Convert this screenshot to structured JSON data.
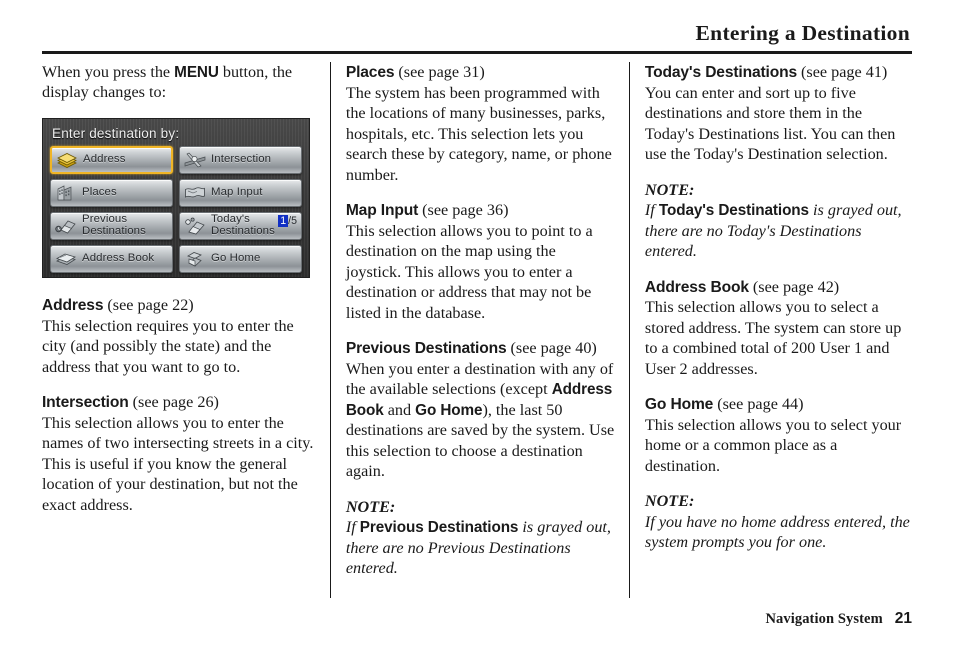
{
  "header": {
    "title": "Entering a Destination"
  },
  "footer": {
    "label": "Navigation System",
    "page": "21"
  },
  "left_column": {
    "intro_pre": "When you press the ",
    "intro_bold": "MENU",
    "intro_post": " button, the display changes to:",
    "nav_screen": {
      "title": "Enter destination by:",
      "buttons": [
        {
          "label": "Address",
          "icon": "address-stack-icon",
          "selected": true,
          "counter": null
        },
        {
          "label": "Intersection",
          "icon": "intersection-roads-icon",
          "selected": false,
          "counter": null
        },
        {
          "label": "Places",
          "icon": "places-buildings-icon",
          "selected": false,
          "counter": null
        },
        {
          "label": "Map Input",
          "icon": "map-input-icon",
          "selected": false,
          "counter": null
        },
        {
          "label": "Previous\nDestinations",
          "icon": "previous-destinations-icon",
          "selected": false,
          "counter": null
        },
        {
          "label": "Today's\nDestinations",
          "icon": "todays-destinations-icon",
          "selected": false,
          "counter": {
            "current": "1",
            "total": "/5"
          }
        },
        {
          "label": "Address Book",
          "icon": "address-book-icon",
          "selected": false,
          "counter": null
        },
        {
          "label": "Go Home",
          "icon": "go-home-icon",
          "selected": false,
          "counter": null
        }
      ]
    },
    "sections": [
      {
        "heading": "Address",
        "ref": " (see page 22)",
        "body": "This selection requires you to enter the city (and possibly the state) and the address that you want to go to."
      },
      {
        "heading": "Intersection",
        "ref": " (see page 26)",
        "body": "This selection allows you to enter the names of two intersecting streets in a city. This is useful if you know the general location of your destination, but not the exact address."
      }
    ]
  },
  "middle_column": {
    "places": {
      "heading": "Places",
      "ref": " (see page 31)",
      "body": "The system has been programmed with the locations of many businesses, parks, hospitals, etc. This selection lets you search these by category, name, or phone number."
    },
    "map_input": {
      "heading": "Map Input",
      "ref": " (see page 36)",
      "body": "This selection allows you to point to a destination on the map using the joystick. This allows you to enter a destination or address that may not be listed in the database."
    },
    "previous_destinations": {
      "heading": "Previous Destinations",
      "ref": " (see page 40)",
      "body_1": "When you enter a destination with any of the available selections (except ",
      "bold_1": "Address Book",
      "body_2": " and ",
      "bold_2": "Go Home",
      "body_3": "), the last 50 destinations are saved by the system. Use this selection to choose a destination again."
    },
    "note": {
      "label": "NOTE:",
      "pre": "If ",
      "bold": "Previous Destinations",
      "post": " is grayed out, there are no Previous Destinations entered."
    }
  },
  "right_column": {
    "todays_destinations": {
      "heading": "Today's Destinations",
      "ref": " (see page 41)",
      "body": "You can enter and sort up to five destinations and store them in the Today's Destinations list. You can then use the Today's Destination selection."
    },
    "note_1": {
      "label": "NOTE:",
      "pre": "If ",
      "bold": "Today's Destinations",
      "post": " is grayed out, there are no Today's Destinations entered."
    },
    "address_book": {
      "heading": "Address Book",
      "ref": " (see page 42)",
      "body": "This selection allows you to select a stored address. The system can store up to a combined total of  200 User 1 and User 2 addresses."
    },
    "go_home": {
      "heading": "Go Home",
      "ref": " (see page 44)",
      "body": "This selection allows you to select your home or a common place as a destination."
    },
    "note_2": {
      "label": "NOTE:",
      "body": "If you have no home address entered, the system prompts you for one."
    }
  }
}
